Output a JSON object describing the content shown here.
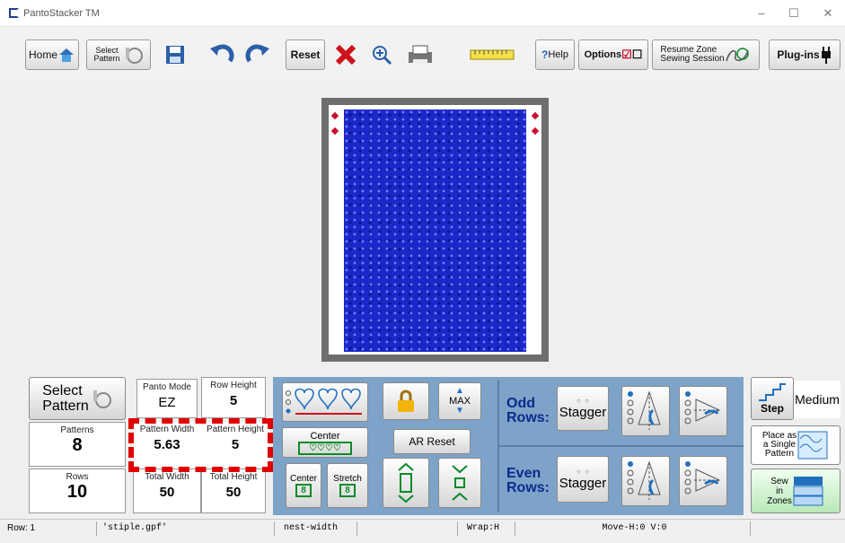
{
  "window": {
    "title": "PantoStacker TM"
  },
  "toolbar": {
    "home": "Home",
    "select_pattern_line1": "Select",
    "select_pattern_line2": "Pattern",
    "reset": "Reset",
    "help": "Help",
    "options": "Options",
    "resume_line1": "Resume Zone",
    "resume_line2": "Sewing Session",
    "plugins": "Plug-ins"
  },
  "left": {
    "select_line1": "Select",
    "select_line2": "Pattern",
    "panto_mode_label": "Panto Mode",
    "panto_mode_value": "EZ",
    "row_height_label": "Row Height",
    "row_height_value": "5",
    "patterns_label": "Patterns",
    "patterns_value": "8",
    "pattern_width_label": "Pattern Width",
    "pattern_width_value": "5.63",
    "pattern_height_label": "Pattern Height",
    "pattern_height_value": "5",
    "rows_label": "Rows",
    "rows_value": "10",
    "total_width_label": "Total Width",
    "total_width_value": "50",
    "total_height_label": "Total Height",
    "total_height_value": "50"
  },
  "center": {
    "center_label": "Center",
    "ar_reset": "AR Reset",
    "max": "MAX",
    "center_small": "Center",
    "stretch_small": "Stretch"
  },
  "rows": {
    "odd_line1": "Odd",
    "odd_line2": "Rows:",
    "even_line1": "Even",
    "even_line2": "Rows:",
    "stagger_odd": "Stagger",
    "stagger_even": "Stagger"
  },
  "right": {
    "step": "Step",
    "medium": "Medium",
    "place_single_line1": "Place as",
    "place_single_line2": "a Single",
    "place_single_line3": "Pattern",
    "sew_zones_line1": "Sew",
    "sew_zones_line2": "in",
    "sew_zones_line3": "Zones"
  },
  "status": {
    "row": "Row: 1",
    "file": "'stiple.gpf'",
    "mode": "nest-width",
    "wrap": "Wrap:H",
    "move": "Move-H:0 V:0"
  },
  "colors": {
    "quilt": "#1a28c8",
    "panel": "#7da3c8",
    "highlight": "#e00000"
  }
}
